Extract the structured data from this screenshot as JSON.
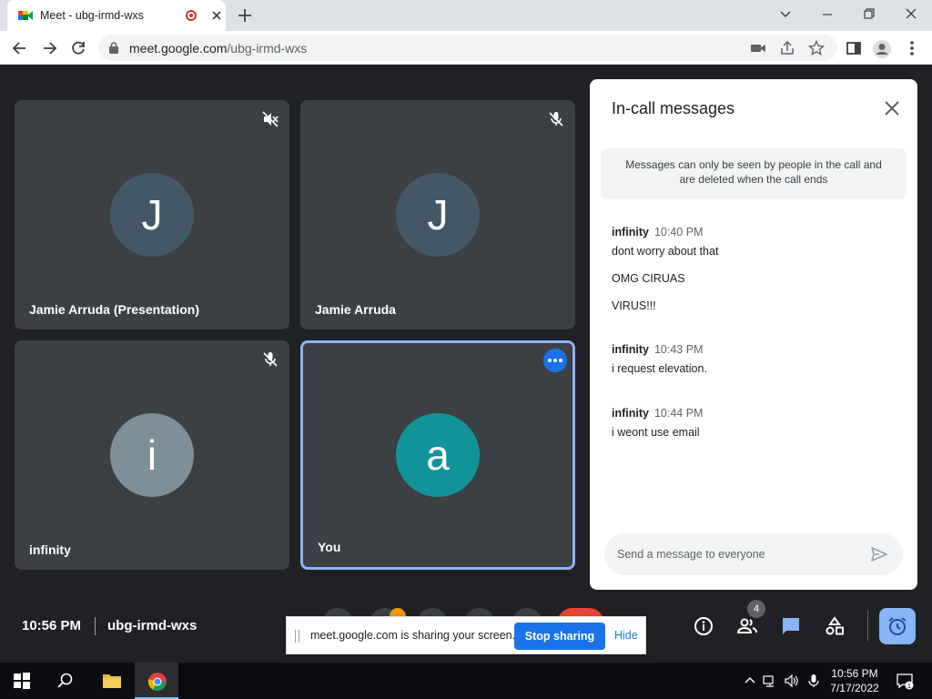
{
  "browser": {
    "tab_title": "Meet - ubg-irmd-wxs",
    "url_host": "meet.google.com",
    "url_path": "/ubg-irmd-wxs"
  },
  "tiles": [
    {
      "name": "Jamie Arruda (Presentation)",
      "initial": "J",
      "avatar_color": "#425866",
      "mic": "muted"
    },
    {
      "name": "Jamie Arruda",
      "initial": "J",
      "avatar_color": "#425866",
      "mic": "muted"
    },
    {
      "name": "infinity",
      "initial": "i",
      "avatar_color": "#7d8f99",
      "mic": "muted"
    },
    {
      "name": "You",
      "initial": "a",
      "avatar_color": "#12939a",
      "mic": "on"
    }
  ],
  "chat": {
    "title": "In-call messages",
    "notice_line1": "Messages can only be seen by people in the call and",
    "notice_line2": "are deleted when the call ends",
    "groups": [
      {
        "sender": "infinity",
        "time": "10:40 PM",
        "messages": [
          "dont worry about that",
          "OMG CIRUAS",
          "VIRUS!!!"
        ]
      },
      {
        "sender": "infinity",
        "time": "10:43 PM",
        "messages": [
          "i request elevation."
        ]
      },
      {
        "sender": "infinity",
        "time": "10:44 PM",
        "messages": [
          "i weont use email"
        ]
      }
    ],
    "input_placeholder": "Send a message to everyone"
  },
  "bottom_bar": {
    "time": "10:56 PM",
    "meeting_code": "ubg-irmd-wxs",
    "participant_count": "4"
  },
  "share_bar": {
    "text": "meet.google.com is sharing your screen.",
    "stop_label": "Stop sharing",
    "hide_label": "Hide"
  },
  "taskbar": {
    "time": "10:56 PM",
    "date": "7/17/2022",
    "notification_count": "1"
  },
  "colors": {
    "meet_bg": "#202124",
    "tile_bg": "#3c4043",
    "accent_blue": "#1a73e8",
    "self_border": "#8ab4f8",
    "end_call_red": "#ea4335"
  }
}
